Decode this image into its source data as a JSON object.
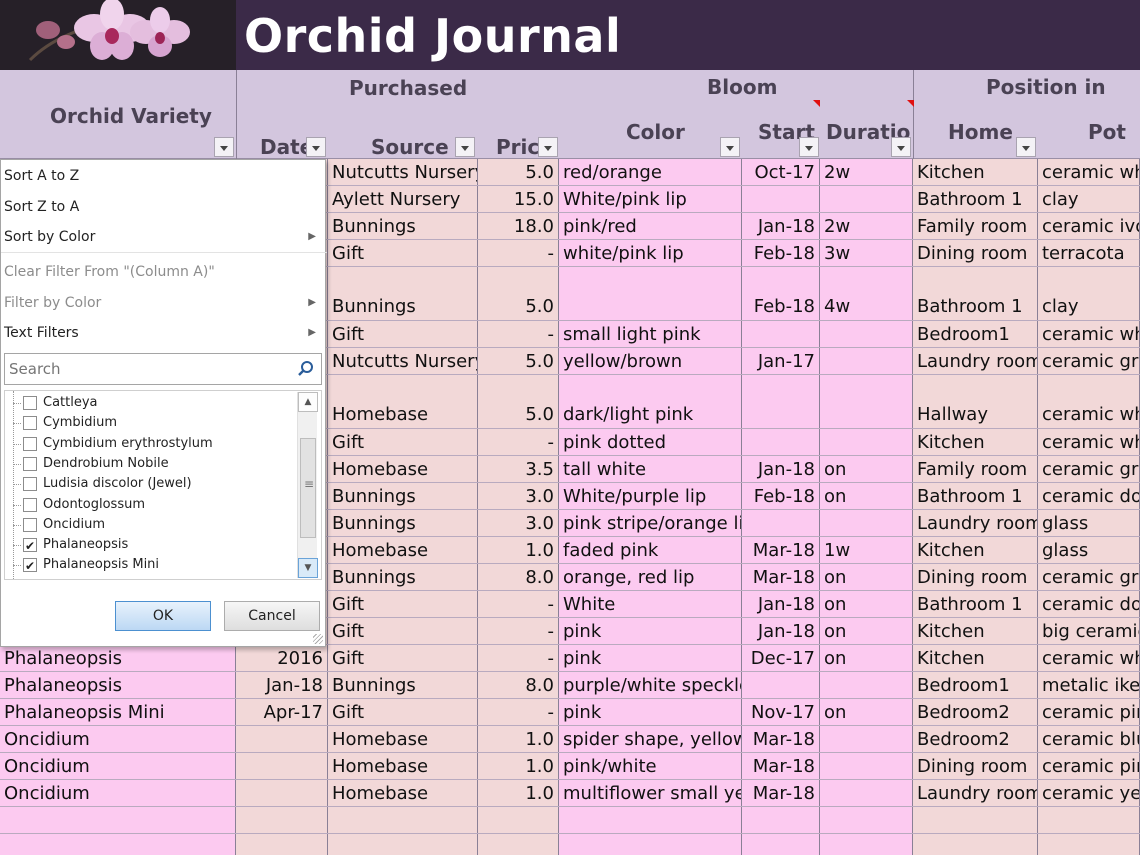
{
  "title": "Orchid Journal",
  "header": {
    "groups": {
      "purchased": "Purchased",
      "bloom": "Bloom",
      "position": "Position in"
    },
    "columns": {
      "variety": "Orchid Variety",
      "date": "Date",
      "source": "Source",
      "price": "Price",
      "color": "Color",
      "start": "Start",
      "duration": "Duration",
      "home": "Home",
      "pot": "Pot"
    }
  },
  "rows": [
    {
      "variety": "",
      "date": "",
      "source": "Nutcutts Nursery",
      "price": "5.0",
      "color": "red/orange",
      "start": "Oct-17",
      "duration": "2w",
      "home": "Kitchen",
      "pot": "ceramic whi"
    },
    {
      "variety": "",
      "date": "",
      "source": "Aylett Nursery",
      "price": "15.0",
      "color": "White/pink lip",
      "start": "",
      "duration": "",
      "home": "Bathroom 1",
      "pot": "clay"
    },
    {
      "variety": "",
      "date": "",
      "source": "Bunnings",
      "price": "18.0",
      "color": "pink/red",
      "start": "Jan-18",
      "duration": "2w",
      "home": "Family room",
      "pot": "ceramic ivor"
    },
    {
      "variety": "",
      "date": "",
      "source": "Gift",
      "price": "-",
      "color": "white/pink lip",
      "start": "Feb-18",
      "duration": "3w",
      "home": "Dining room",
      "pot": "terracota"
    },
    {
      "variety": "",
      "date": "",
      "source": "Bunnings",
      "price": "5.0",
      "color": "",
      "start": "Feb-18",
      "duration": "4w",
      "home": "Bathroom 1",
      "pot": "clay"
    },
    {
      "variety": "",
      "date": "",
      "source": "Gift",
      "price": "-",
      "color": "small light pink",
      "start": "",
      "duration": "",
      "home": "Bedroom1",
      "pot": "ceramic whi"
    },
    {
      "variety": "",
      "date": "",
      "source": "Nutcutts Nursery",
      "price": "5.0",
      "color": "yellow/brown",
      "start": "Jan-17",
      "duration": "",
      "home": "Laundry room",
      "pot": "ceramic grey"
    },
    {
      "variety": "",
      "date": "",
      "source": "Homebase",
      "price": "5.0",
      "color": "dark/light pink",
      "start": "",
      "duration": "",
      "home": "Hallway",
      "pot": "ceramic whi"
    },
    {
      "variety": "",
      "date": "",
      "source": "Gift",
      "price": "-",
      "color": "pink dotted",
      "start": "",
      "duration": "",
      "home": "Kitchen",
      "pot": "ceramic whi"
    },
    {
      "variety": "",
      "date": "",
      "source": "Homebase",
      "price": "3.5",
      "color": "tall white",
      "start": "Jan-18",
      "duration": "on",
      "home": "Family room",
      "pot": "ceramic grey"
    },
    {
      "variety": "",
      "date": "",
      "source": "Bunnings",
      "price": "3.0",
      "color": "White/purple lip",
      "start": "Feb-18",
      "duration": "on",
      "home": "Bathroom 1",
      "pot": "ceramic dou"
    },
    {
      "variety": "",
      "date": "",
      "source": "Bunnings",
      "price": "3.0",
      "color": "pink stripe/orange lip",
      "start": "",
      "duration": "",
      "home": "Laundry room",
      "pot": "glass"
    },
    {
      "variety": "",
      "date": "",
      "source": "Homebase",
      "price": "1.0",
      "color": "faded pink",
      "start": "Mar-18",
      "duration": "1w",
      "home": "Kitchen",
      "pot": "glass"
    },
    {
      "variety": "",
      "date": "",
      "source": "Bunnings",
      "price": "8.0",
      "color": "orange, red lip",
      "start": "Mar-18",
      "duration": "on",
      "home": "Dining room",
      "pot": "ceramic grey"
    },
    {
      "variety": "",
      "date": "",
      "source": "Gift",
      "price": "-",
      "color": "White",
      "start": "Jan-18",
      "duration": "on",
      "home": "Bathroom 1",
      "pot": "ceramic dou"
    },
    {
      "variety": "",
      "date": "",
      "source": "Gift",
      "price": "-",
      "color": "pink",
      "start": "Jan-18",
      "duration": "on",
      "home": "Kitchen",
      "pot": "big ceramic"
    },
    {
      "variety": "Phalaneopsis",
      "date": "2016",
      "source": "Gift",
      "price": "-",
      "color": "pink",
      "start": "Dec-17",
      "duration": "on",
      "home": "Kitchen",
      "pot": "ceramic whi"
    },
    {
      "variety": "Phalaneopsis",
      "date": "Jan-18",
      "source": "Bunnings",
      "price": "8.0",
      "color": "purple/white speckled",
      "start": "",
      "duration": "",
      "home": "Bedroom1",
      "pot": "metalic ikea"
    },
    {
      "variety": "Phalaneopsis Mini",
      "date": "Apr-17",
      "source": "Gift",
      "price": "-",
      "color": "pink",
      "start": "Nov-17",
      "duration": "on",
      "home": "Bedroom2",
      "pot": "ceramic pink"
    },
    {
      "variety": "Oncidium",
      "date": "",
      "source": "Homebase",
      "price": "1.0",
      "color": "spider shape, yellow",
      "start": "Mar-18",
      "duration": "",
      "home": "Bedroom2",
      "pot": "ceramic blue"
    },
    {
      "variety": "Oncidium",
      "date": "",
      "source": "Homebase",
      "price": "1.0",
      "color": "pink/white",
      "start": "Mar-18",
      "duration": "",
      "home": "Dining room",
      "pot": "ceramic pink"
    },
    {
      "variety": "Oncidium",
      "date": "",
      "source": "Homebase",
      "price": "1.0",
      "color": "multiflower small yellow",
      "start": "Mar-18",
      "duration": "",
      "home": "Laundry room",
      "pot": "ceramic yell"
    },
    {
      "variety": "",
      "date": "",
      "source": "",
      "price": "",
      "color": "",
      "start": "",
      "duration": "",
      "home": "",
      "pot": ""
    },
    {
      "variety": "",
      "date": "",
      "source": "",
      "price": "",
      "color": "",
      "start": "",
      "duration": "",
      "home": "",
      "pot": ""
    }
  ],
  "filter_menu": {
    "sort_az": "Sort A to Z",
    "sort_za": "Sort Z to A",
    "sort_color": "Sort by Color",
    "clear_filter": "Clear Filter From \"(Column A)\"",
    "filter_color": "Filter by Color",
    "text_filters": "Text Filters",
    "search_placeholder": "Search",
    "items": [
      {
        "label": "Cattleya",
        "checked": false
      },
      {
        "label": "Cymbidium",
        "checked": false
      },
      {
        "label": "Cymbidium erythrostylum",
        "checked": false
      },
      {
        "label": "Dendrobium Nobile",
        "checked": false
      },
      {
        "label": "Ludisia discolor (Jewel)",
        "checked": false
      },
      {
        "label": "Odontoglossum",
        "checked": false
      },
      {
        "label": "Oncidium",
        "checked": false
      },
      {
        "label": "Phalaneopsis",
        "checked": true
      },
      {
        "label": "Phalaneopsis Mini",
        "checked": true
      }
    ],
    "ok_label": "OK",
    "cancel_label": "Cancel"
  },
  "colors": {
    "title_band": "#3b2a48",
    "header_fill": "#d3c6de",
    "cell_pink": "#fccaf0",
    "cell_peach": "#f2d8d8"
  }
}
